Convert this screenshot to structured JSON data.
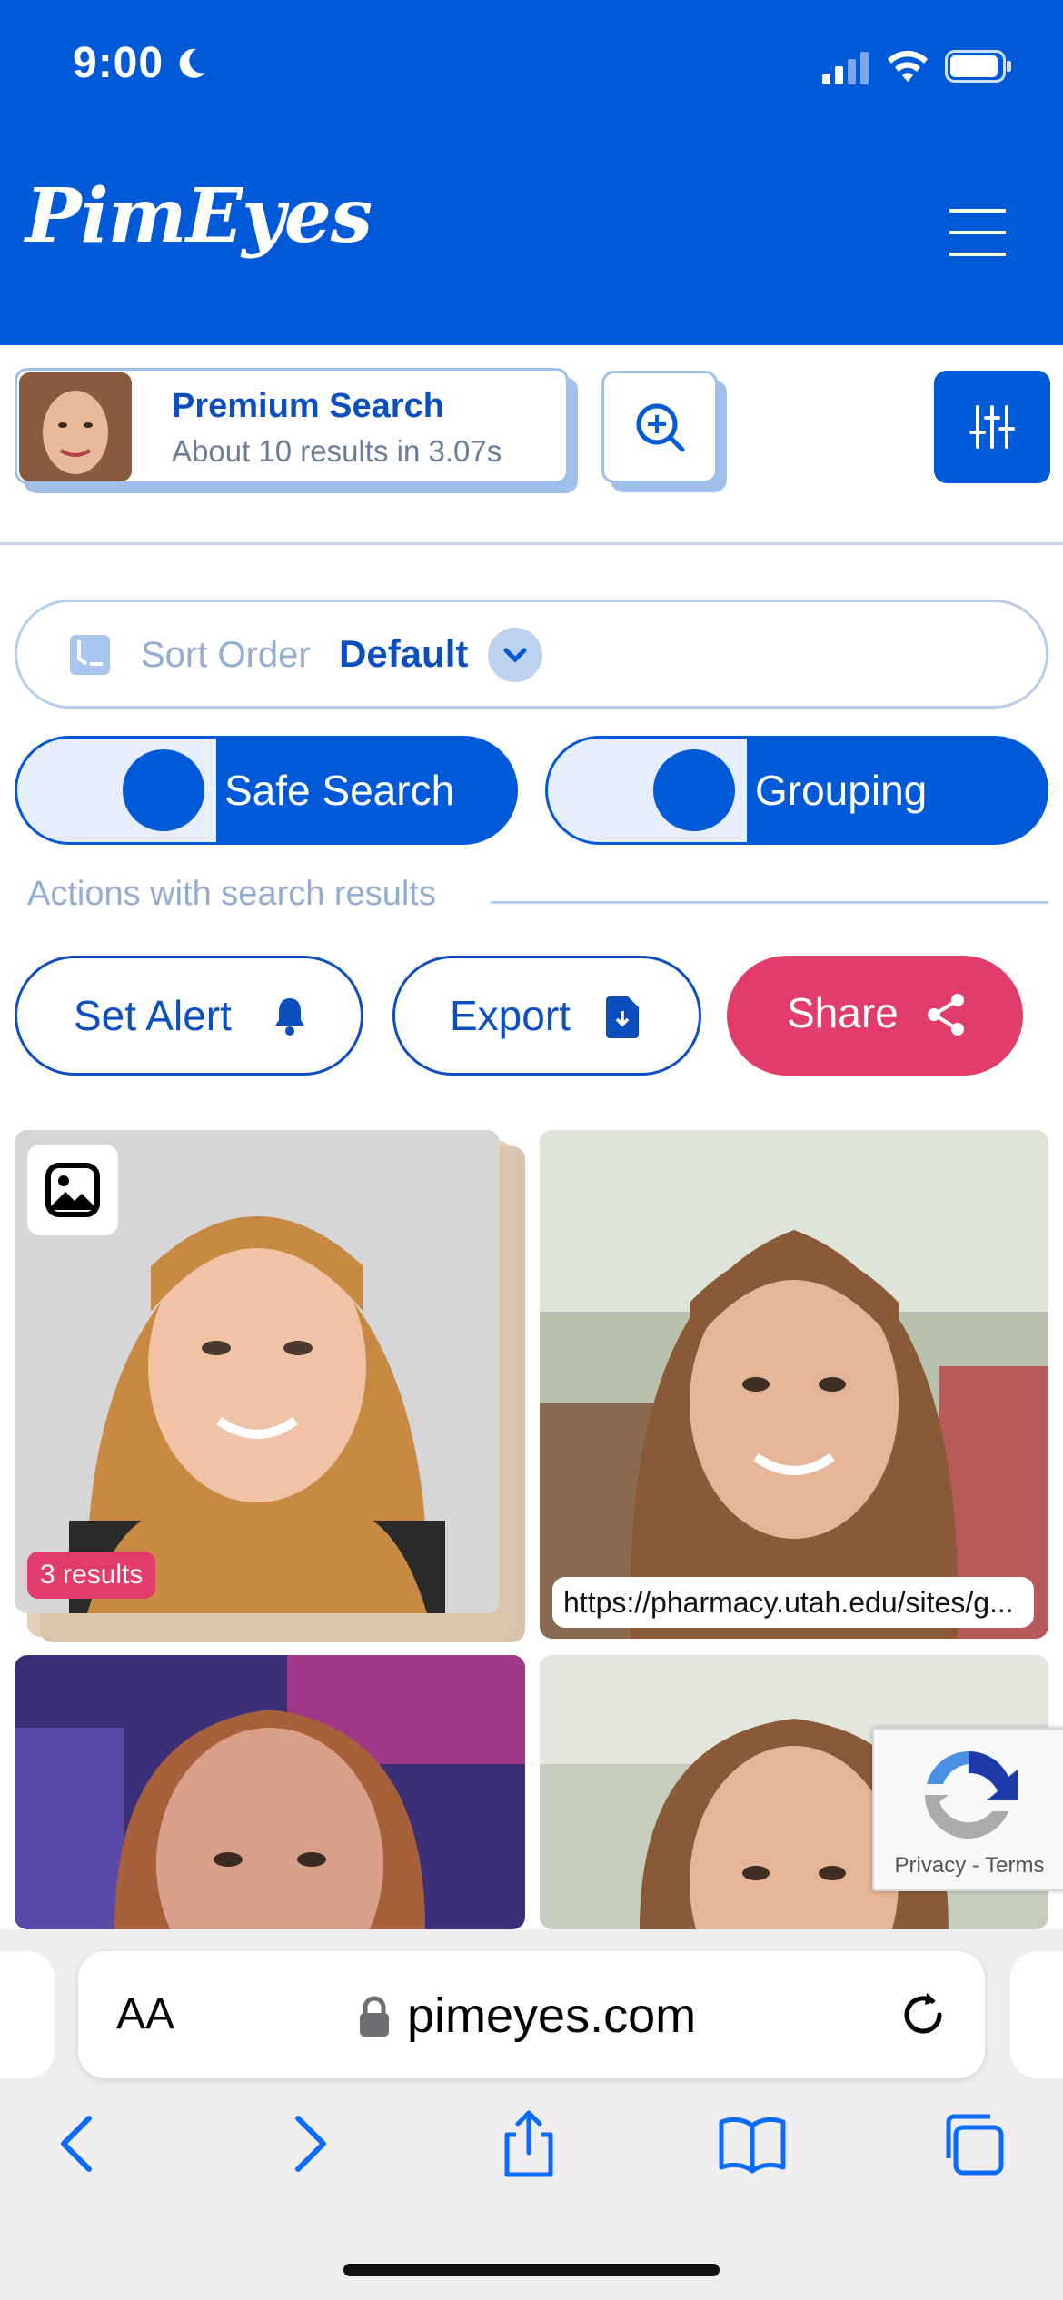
{
  "status_bar": {
    "time": "9:00"
  },
  "header": {
    "logo": "PimEyes"
  },
  "search_summary": {
    "title": "Premium Search",
    "subtitle": "About 10 results in 3.07s"
  },
  "sort": {
    "label": "Sort Order",
    "value": "Default"
  },
  "toggles": [
    {
      "label": "Safe Search"
    },
    {
      "label": "Grouping"
    }
  ],
  "actions": {
    "heading": "Actions with search results",
    "set_alert": "Set Alert",
    "export": "Export",
    "share": "Share"
  },
  "results": [
    {
      "badge": "3 results"
    },
    {
      "url": "https://pharmacy.utah.edu/sites/g..."
    }
  ],
  "recaptcha": {
    "links": "Privacy - Terms"
  },
  "browser": {
    "text_size": "AA",
    "url": "pimeyes.com"
  },
  "colors": {
    "brand": "#0059d6",
    "share": "#e23d6a",
    "light_blue": "#9fc0ea"
  }
}
